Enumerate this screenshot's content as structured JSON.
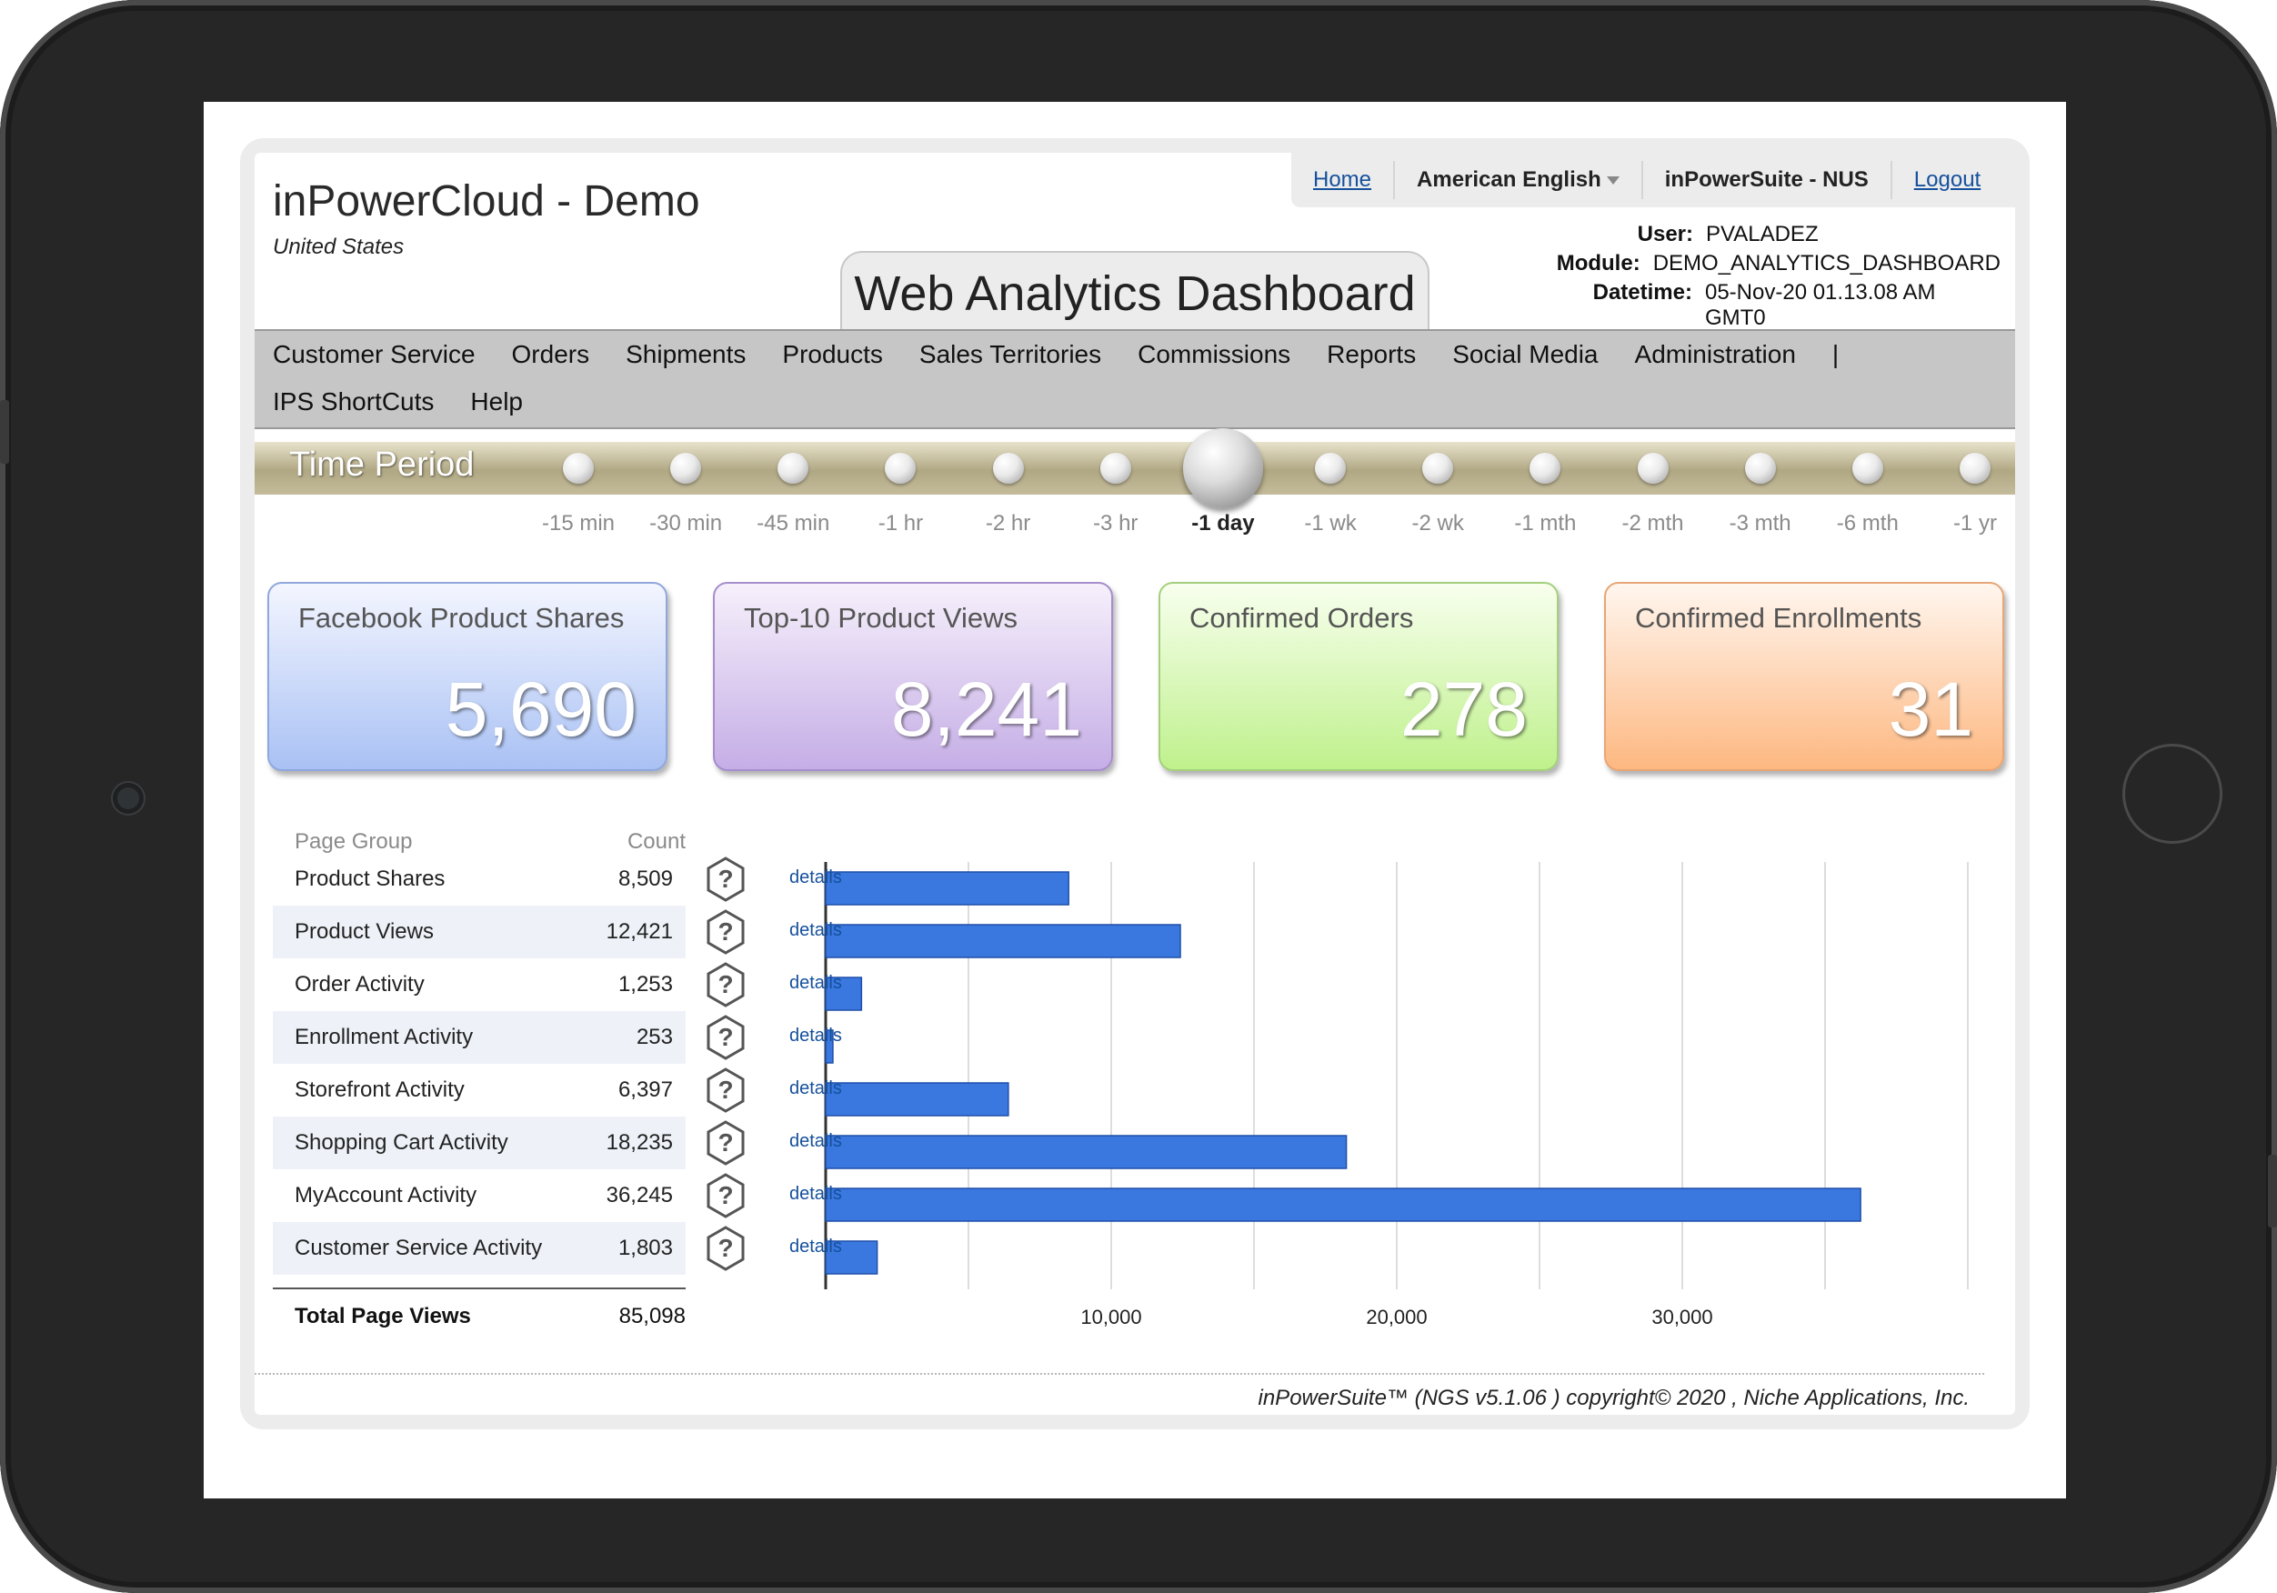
{
  "app": {
    "title": "inPowerCloud - Demo",
    "subtitle": "United States"
  },
  "topnav": {
    "home": "Home",
    "language": "American English",
    "suite": "inPowerSuite - NUS",
    "logout": "Logout"
  },
  "dashboard_title": "Web Analytics Dashboard",
  "userinfo": {
    "user_label": "User:",
    "user": "PVALADEZ",
    "module_label": "Module:",
    "module": "DEMO_ANALYTICS_DASHBOARD",
    "datetime_label": "Datetime:",
    "datetime": "05-Nov-20 01.13.08 AM GMT0"
  },
  "menu": [
    "Customer Service",
    "Orders",
    "Shipments",
    "Products",
    "Sales Territories",
    "Commissions",
    "Reports",
    "Social Media",
    "Administration",
    "|",
    "IPS ShortCuts",
    "Help"
  ],
  "time_period": {
    "title": "Time Period",
    "options": [
      "-15 min",
      "-30 min",
      "-45 min",
      "-1 hr",
      "-2 hr",
      "-3 hr",
      "-1 day",
      "-1 wk",
      "-2 wk",
      "-1 mth",
      "-2 mth",
      "-3 mth",
      "-6 mth",
      "-1 yr"
    ],
    "selected": "-1 day"
  },
  "cards": [
    {
      "title": "Facebook Product Shares",
      "value": "5,690"
    },
    {
      "title": "Top-10 Product Views",
      "value": "8,241"
    },
    {
      "title": "Confirmed Orders",
      "value": "278"
    },
    {
      "title": "Confirmed Enrollments",
      "value": "31"
    }
  ],
  "table": {
    "header_group": "Page Group",
    "header_count": "Count",
    "details_label": "details",
    "rows": [
      {
        "group": "Product Shares",
        "count": "8,509"
      },
      {
        "group": "Product Views",
        "count": "12,421"
      },
      {
        "group": "Order Activity",
        "count": "1,253"
      },
      {
        "group": "Enrollment Activity",
        "count": "253"
      },
      {
        "group": "Storefront Activity",
        "count": "6,397"
      },
      {
        "group": "Shopping Cart Activity",
        "count": "18,235"
      },
      {
        "group": "MyAccount Activity",
        "count": "36,245"
      },
      {
        "group": "Customer Service Activity",
        "count": "1,803"
      }
    ],
    "total_label": "Total Page Views",
    "total_value": "85,098"
  },
  "chart_data": {
    "type": "bar",
    "orientation": "horizontal",
    "categories": [
      "Product Shares",
      "Product Views",
      "Order Activity",
      "Enrollment Activity",
      "Storefront Activity",
      "Shopping Cart Activity",
      "MyAccount Activity",
      "Customer Service Activity"
    ],
    "values": [
      8509,
      12421,
      1253,
      253,
      6397,
      18235,
      36245,
      1803
    ],
    "xlim": [
      0,
      40000
    ],
    "xticks": [
      10000,
      20000,
      30000
    ],
    "xtick_labels": [
      "10,000",
      "20,000",
      "30,000"
    ],
    "grid": true,
    "bar_color": "#3a78e0"
  },
  "footer": "inPowerSuite™ (NGS v5.1.06 ) copyright© 2020 , Niche Applications, Inc."
}
